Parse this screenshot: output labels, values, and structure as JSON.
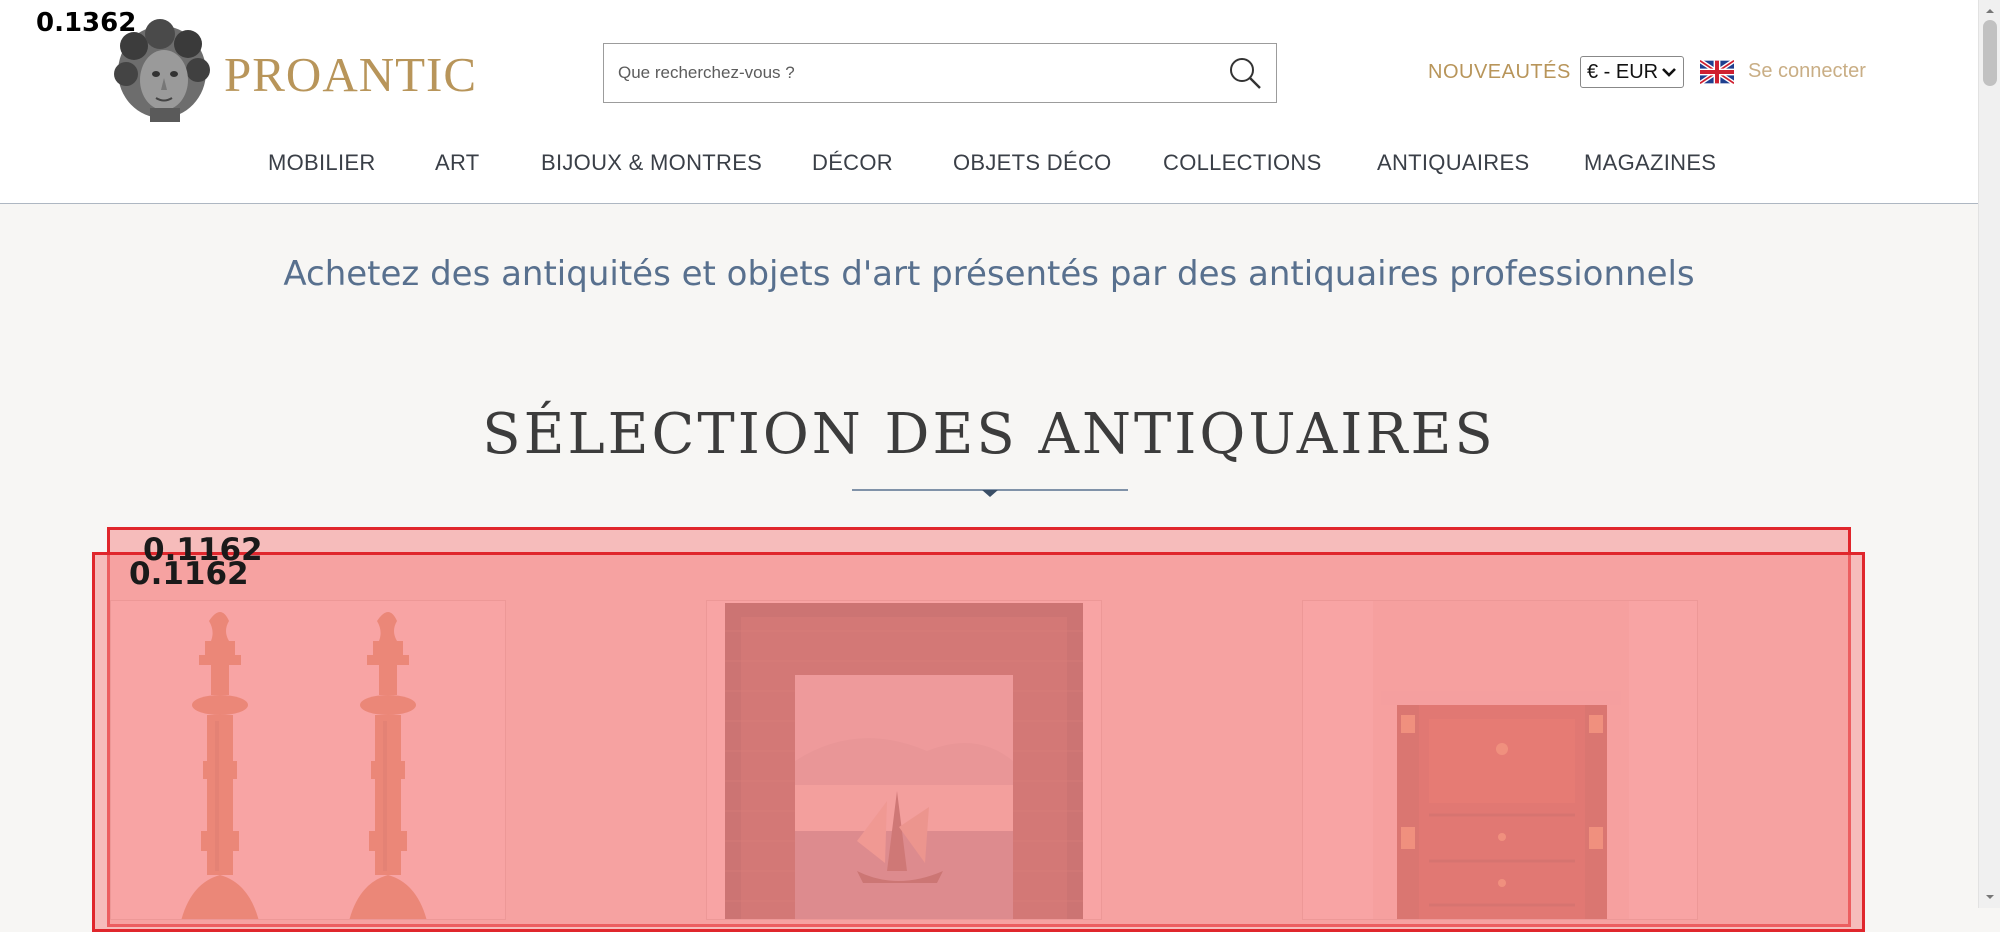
{
  "header": {
    "logo_text": "PROANTIC",
    "search": {
      "placeholder": "Que recherchez-vous ?",
      "value": ""
    },
    "new_link": "NOUVEAUTÉS",
    "currency": "€ - EUR",
    "login": "Se connecter"
  },
  "nav": {
    "items": [
      {
        "label": "MOBILIER"
      },
      {
        "label": "ART"
      },
      {
        "label": "BIJOUX & MONTRES"
      },
      {
        "label": "DÉCOR"
      },
      {
        "label": "OBJETS DÉCO"
      },
      {
        "label": "COLLECTIONS"
      },
      {
        "label": "ANTIQUAIRES"
      },
      {
        "label": "MAGAZINES"
      }
    ]
  },
  "main": {
    "tagline": "Achetez des antiquités et objets d'art présentés par des antiquaires professionnels",
    "section_title": "SÉLECTION DES ANTIQUAIRES"
  },
  "overlays": {
    "top_score": "0.1362",
    "box_score_a": "0.1162",
    "box_score_b": "0.1162"
  },
  "colors": {
    "gold": "#b8955a",
    "nav_text": "#3a3f47",
    "tagline": "#58708e",
    "overlay_border": "#e0262c"
  },
  "icons": {
    "search": "magnifier",
    "flag": "uk-flag",
    "logo": "medusa-bust"
  }
}
